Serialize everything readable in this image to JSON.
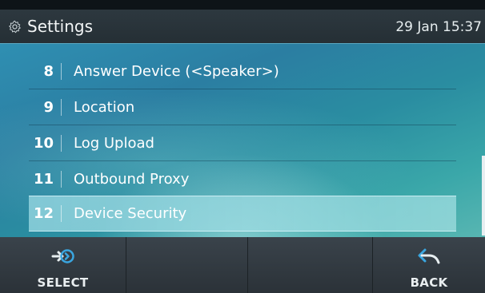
{
  "header": {
    "title": "Settings",
    "clock": "29 Jan 15:37",
    "icon": "gear-icon"
  },
  "menu": {
    "items": [
      {
        "number": "8",
        "label": "Answer Device (<Speaker>)",
        "selected": false
      },
      {
        "number": "9",
        "label": "Location",
        "selected": false
      },
      {
        "number": "10",
        "label": "Log Upload",
        "selected": false
      },
      {
        "number": "11",
        "label": "Outbound Proxy",
        "selected": false
      },
      {
        "number": "12",
        "label": "Device Security",
        "selected": true
      }
    ]
  },
  "softkeys": {
    "select": {
      "label": "SELECT",
      "icon": "select-arrow-icon"
    },
    "back": {
      "label": "BACK",
      "icon": "back-arrow-icon"
    },
    "accent_color": "#3aa6e0"
  }
}
